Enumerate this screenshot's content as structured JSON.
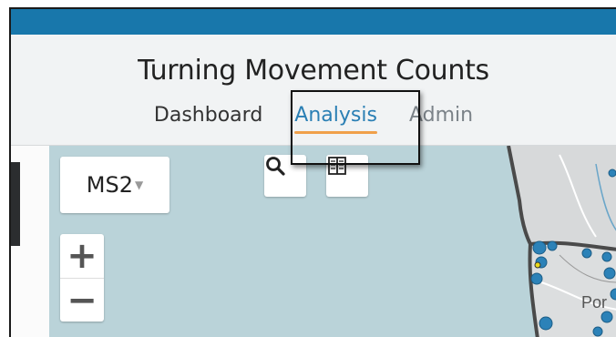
{
  "header": {
    "title": "Turning Movement Counts",
    "nav": [
      {
        "label": "Dashboard",
        "state": "default"
      },
      {
        "label": "Analysis",
        "state": "active"
      },
      {
        "label": "Admin",
        "state": "disabled"
      }
    ]
  },
  "map": {
    "layer_select": {
      "value": "MS2"
    },
    "zoom_in_label": "+",
    "zoom_out_label": "−",
    "search_icon": "search-icon",
    "layers_icon": "map-book-icon",
    "place_label": "Por"
  },
  "colors": {
    "topbar": "#1877ab",
    "accent": "#2a7fb4",
    "active_underline": "#f0a04a",
    "water": "#bad3d9",
    "land": "#d9dbdc",
    "marker": "#2c82b8"
  }
}
